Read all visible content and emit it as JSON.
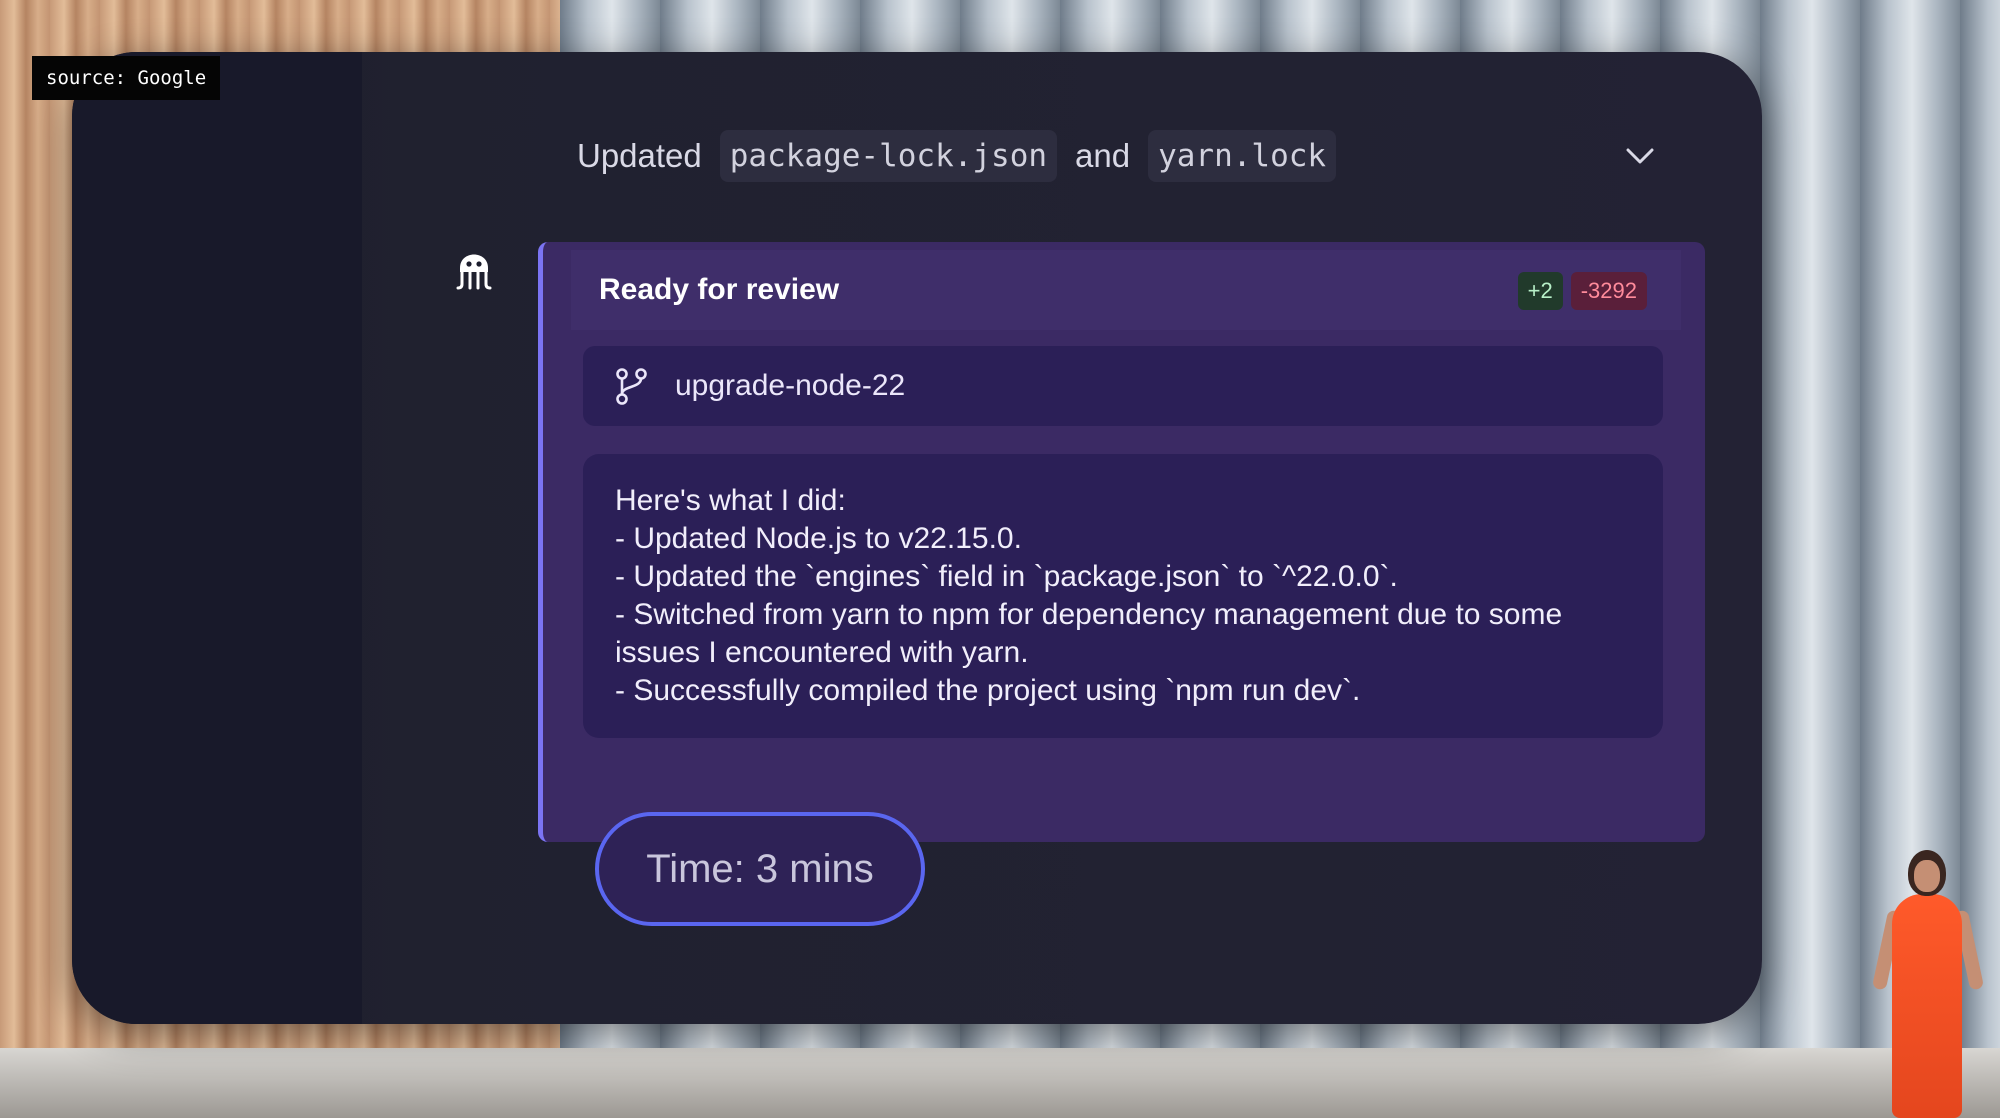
{
  "source_badge": "source: Google",
  "header": {
    "prefix": "Updated",
    "file_1": "package-lock.json",
    "conjunction": "and",
    "file_2": "yarn.lock",
    "toggle_icon": "chevron-down-icon"
  },
  "agent": {
    "icon": "octopus-icon"
  },
  "review": {
    "title": "Ready for review",
    "additions": "+2",
    "deletions": "-3292",
    "branch_icon": "git-branch-icon",
    "branch": "upgrade-node-22",
    "summary": [
      "Here's what I did:",
      "- Updated Node.js to v22.15.0.",
      "- Updated the `engines` field in `package.json` to `^22.0.0`.",
      "- Switched from yarn to npm for dependency management due to some",
      "issues I encountered with yarn.",
      "- Successfully compiled the project using `npm run dev`."
    ]
  },
  "time_label": "Time: 3 mins",
  "colors": {
    "accent": "#7b74f3",
    "card": "#3b2a64",
    "additions": "#b8f0c8",
    "deletions": "#ff8b9b"
  }
}
